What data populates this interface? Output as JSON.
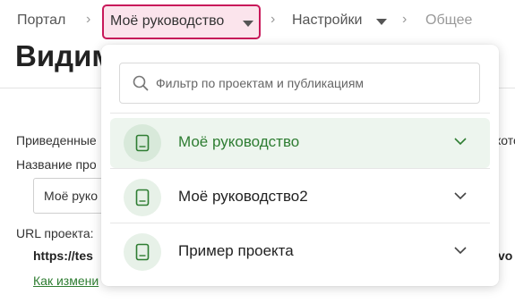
{
  "breadcrumb": {
    "portal": "Портал",
    "separator": "›",
    "current": "Моё руководство",
    "settings": "Настройки",
    "general": "Общее"
  },
  "page": {
    "title": "Видим",
    "description": "Приведенные",
    "description_right": "кото",
    "name_label": "Название про",
    "name_value": "Моё руко",
    "url_label": "URL проекта:",
    "url_value": "https://tes",
    "url_right": "vo",
    "change_link": "Как измени"
  },
  "dropdown": {
    "filter_placeholder": "Фильтр по проектам и публикациям",
    "items": [
      {
        "label": "Моё руководство",
        "active": true,
        "icon": "book-icon"
      },
      {
        "label": "Моё руководство2",
        "active": false,
        "icon": "book-icon"
      },
      {
        "label": "Пример проекта",
        "active": false,
        "icon": "book-icon"
      }
    ]
  },
  "colors": {
    "accent_border": "#c8185a",
    "accent_bg": "#fbe4ec",
    "green": "#2e7d32",
    "active_row": "#edf5ee"
  }
}
